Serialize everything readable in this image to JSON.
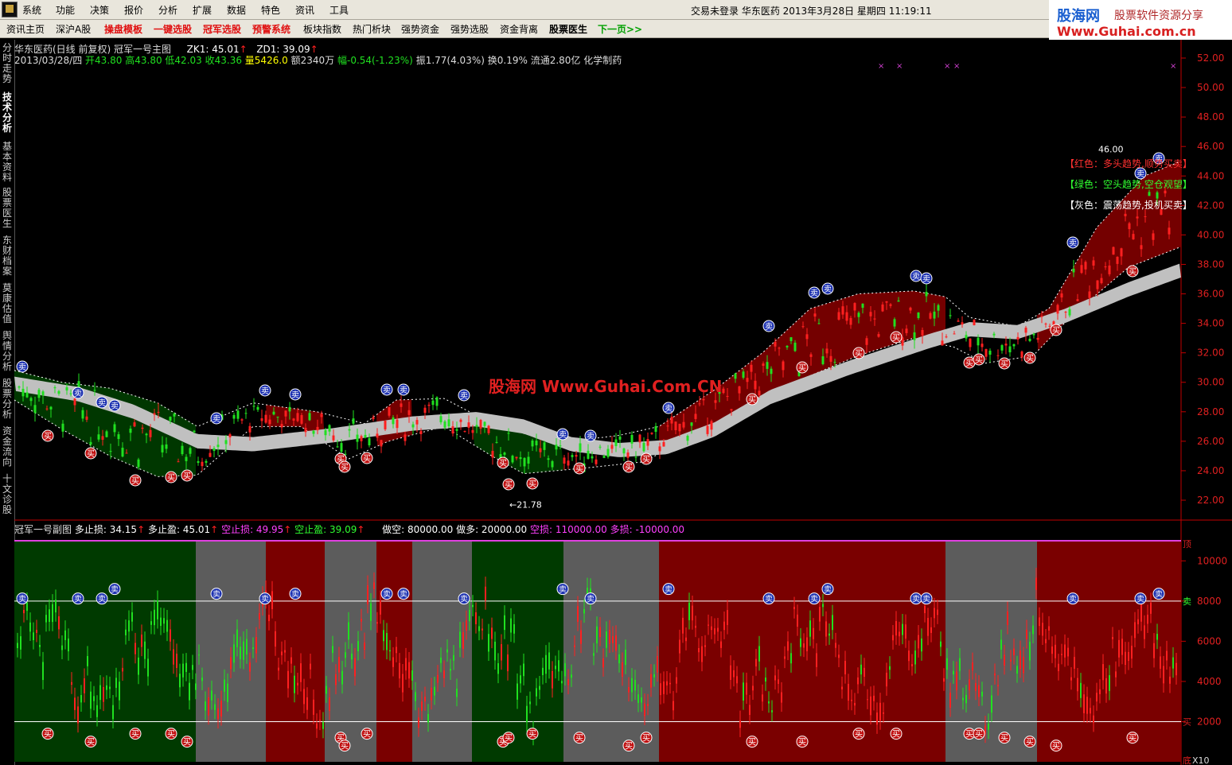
{
  "menu": {
    "items": [
      "系统",
      "功能",
      "决策",
      "报价",
      "分析",
      "扩展",
      "数据",
      "特色",
      "资讯",
      "工具"
    ],
    "status": "交易未登录  华东医药  2013年3月28日  星期四  11:19:11"
  },
  "toolbar": {
    "items": [
      {
        "label": "资讯主页",
        "style": "normal"
      },
      {
        "label": "深沪A股",
        "style": "normal"
      },
      {
        "label": "操盘模板",
        "style": "red"
      },
      {
        "label": "一键选股",
        "style": "red"
      },
      {
        "label": "冠军选股",
        "style": "red"
      },
      {
        "label": "预警系统",
        "style": "red"
      },
      {
        "label": "板块指数",
        "style": "normal"
      },
      {
        "label": "热门析块",
        "style": "normal"
      },
      {
        "label": "强势资金",
        "style": "normal"
      },
      {
        "label": "强势选股",
        "style": "normal"
      },
      {
        "label": "资金背离",
        "style": "normal"
      },
      {
        "label": "股票医生",
        "style": "bold"
      },
      {
        "label": "下一页>>",
        "style": "green"
      }
    ]
  },
  "brand": {
    "top": "股海网",
    "tagline": "股票软件资源分享",
    "url": "Www.Guhai.com.cn"
  },
  "sidebar": {
    "items": [
      {
        "label": "分时走势",
        "active": false
      },
      {
        "label": "技术分析",
        "active": true
      },
      {
        "label": "基本资料",
        "active": false
      },
      {
        "label": "股票医生",
        "active": false
      },
      {
        "label": "东财档案",
        "active": false
      },
      {
        "label": "莫康估值",
        "active": false
      },
      {
        "label": "舆情分析",
        "active": false
      },
      {
        "label": "股票分析",
        "active": false
      },
      {
        "label": "资金流向",
        "active": false
      },
      {
        "label": "十文诊股",
        "active": false
      }
    ]
  },
  "main_header": {
    "title": "华东医药(日线 前复权) 冠军一号主图",
    "zk1": "ZK1: 45.01",
    "zd1": "ZD1: 39.09",
    "date": "2013/03/28/四",
    "open": "开43.80",
    "high": "高43.80",
    "low": "低42.03",
    "close": "收43.36",
    "volume": "量5426.0",
    "amount": "额2340万",
    "change": "幅-0.54(-1.23%)",
    "amplitude": "振1.77(4.03%)",
    "turnover": "换0.19%",
    "float": "流通2.80亿",
    "sector": "化学制药"
  },
  "legend": {
    "red": "【红色：多头趋势,顺势买卖】",
    "green": "【绿色：空头趋势,空仓观望】",
    "gray": "【灰色：震荡趋势,投机买卖】"
  },
  "sub_header": {
    "title": "冠军一号副图",
    "stop_loss_long": "多止损: 34.15",
    "take_profit_long": "多止盈: 45.01",
    "stop_loss_short": "空止损: 49.95",
    "take_profit_short": "空止盈: 39.09",
    "short_val": "做空: 80000.00",
    "long_val": "做多: 20000.00",
    "short_loss": "空损: 110000.00",
    "long_loss": "多损: -10000.00"
  },
  "watermark": "股海网 Www.Guhai.Com.CN",
  "price_axis": [
    "52.00",
    "50.00",
    "48.00",
    "46.00",
    "44.00",
    "42.00",
    "40.00",
    "38.00",
    "36.00",
    "34.00",
    "32.00",
    "30.00",
    "28.00",
    "26.00",
    "24.00",
    "22.00"
  ],
  "osc_axis": [
    "10000",
    "8000",
    "6000",
    "4000",
    "2000"
  ],
  "osc_side_labels": {
    "top": "顶",
    "sell": "卖",
    "buy": "买",
    "bottom": "底",
    "scale": "X10"
  },
  "annotations": {
    "high_label": "46.00",
    "low_label": "21.78"
  },
  "markers": {
    "buy": "买",
    "sell": "卖"
  },
  "colors": {
    "up": "#ff2020",
    "down": "#20e020",
    "band_red": "#7a0000",
    "band_green": "#003a00",
    "band_gray": "#c0c0c0",
    "osc_gray": "#5c5c5c",
    "axis": "#c00000",
    "legend_red": "#ff3030",
    "legend_green": "#30ff30",
    "legend_gray": "#ffffff"
  }
}
